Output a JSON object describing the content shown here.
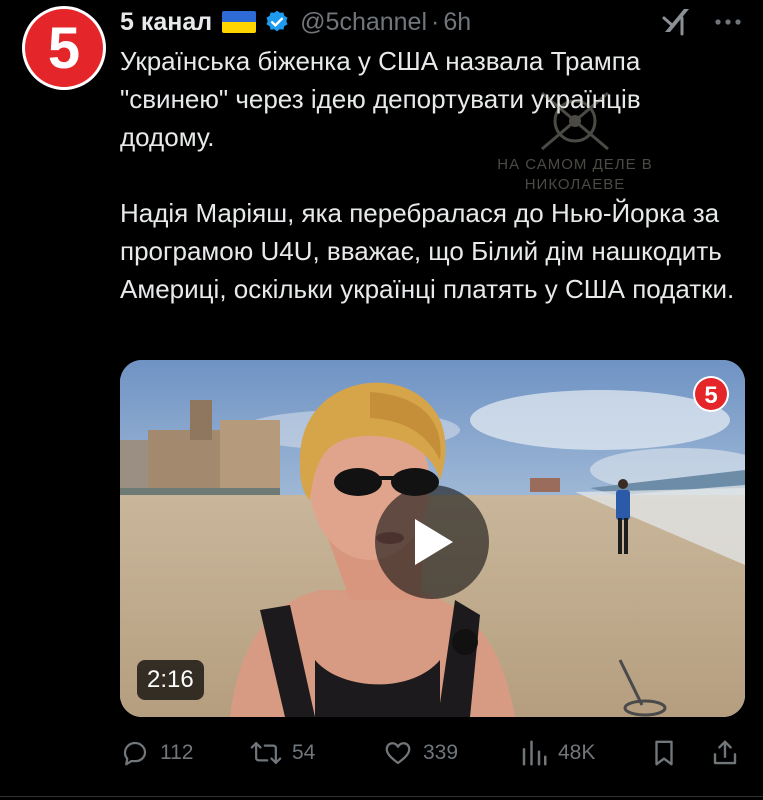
{
  "author": {
    "name": "5 канал",
    "handle": "@5channel",
    "separator": "·",
    "time": "6h",
    "avatar_text": "5"
  },
  "tweet": {
    "paragraph1": "Українська біженка у США назвала Трампа \"свинею\" через ідею депортувати українців додому.",
    "paragraph2": "Надія Маріяш, яка перебралася до Нью-Йорка за програмою U4U, вважає, що Білий дім нашкодить Америці, оскільки українці платять у США податки."
  },
  "watermark": {
    "line1": "НА САМОМ ДЕЛЕ В",
    "line2": "НИКОЛАЕВЕ"
  },
  "media": {
    "duration": "2:16",
    "logo_text": "5"
  },
  "actions": {
    "replies": "112",
    "reposts": "54",
    "likes": "339",
    "views": "48K"
  },
  "colors": {
    "brand_red": "#e4262b",
    "text_primary": "#e7e9ea",
    "text_secondary": "#71767b",
    "verified_blue": "#1d9bf0",
    "background": "#000000"
  },
  "icons": {
    "avatar": "5-channel-logo",
    "verified": "verified-badge-icon",
    "grok": "grok-icon",
    "more": "more-icon",
    "play": "play-icon",
    "reply": "reply-icon",
    "repost": "repost-icon",
    "like": "heart-icon",
    "views": "views-icon",
    "bookmark": "bookmark-icon",
    "share": "share-icon"
  }
}
